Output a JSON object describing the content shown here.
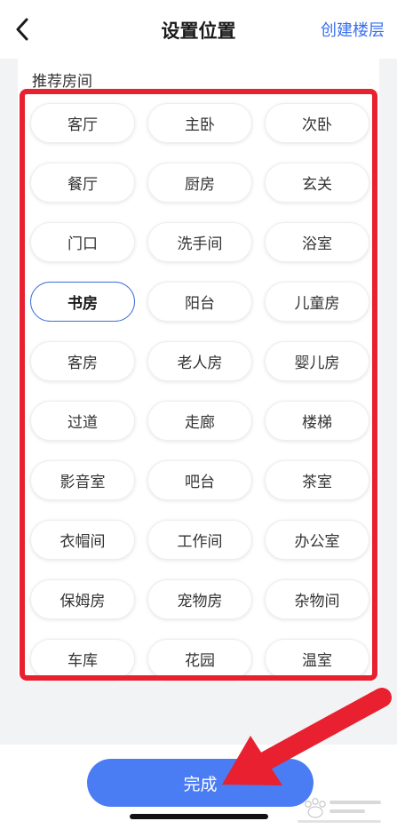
{
  "header": {
    "title": "设置位置",
    "action_label": "创建楼层"
  },
  "section": {
    "label": "推荐房间"
  },
  "rooms": [
    {
      "label": "客厅",
      "selected": false
    },
    {
      "label": "主卧",
      "selected": false
    },
    {
      "label": "次卧",
      "selected": false
    },
    {
      "label": "餐厅",
      "selected": false
    },
    {
      "label": "厨房",
      "selected": false
    },
    {
      "label": "玄关",
      "selected": false
    },
    {
      "label": "门口",
      "selected": false
    },
    {
      "label": "洗手间",
      "selected": false
    },
    {
      "label": "浴室",
      "selected": false
    },
    {
      "label": "书房",
      "selected": true
    },
    {
      "label": "阳台",
      "selected": false
    },
    {
      "label": "儿童房",
      "selected": false
    },
    {
      "label": "客房",
      "selected": false
    },
    {
      "label": "老人房",
      "selected": false
    },
    {
      "label": "婴儿房",
      "selected": false
    },
    {
      "label": "过道",
      "selected": false
    },
    {
      "label": "走廊",
      "selected": false
    },
    {
      "label": "楼梯",
      "selected": false
    },
    {
      "label": "影音室",
      "selected": false
    },
    {
      "label": "吧台",
      "selected": false
    },
    {
      "label": "茶室",
      "selected": false
    },
    {
      "label": "衣帽间",
      "selected": false
    },
    {
      "label": "工作间",
      "selected": false
    },
    {
      "label": "办公室",
      "selected": false
    },
    {
      "label": "保姆房",
      "selected": false
    },
    {
      "label": "宠物房",
      "selected": false
    },
    {
      "label": "杂物间",
      "selected": false
    },
    {
      "label": "车库",
      "selected": false
    },
    {
      "label": "花园",
      "selected": false
    },
    {
      "label": "温室",
      "selected": false
    }
  ],
  "footer": {
    "done_label": "完成"
  },
  "colors": {
    "accent": "#4a7cf3",
    "annotation_red": "#e8202f",
    "selected_border": "#3b6fd8"
  },
  "icons": {
    "back": "back-chevron-icon",
    "annotation": "red-arrow-icon",
    "watermark": "baidu-paw-watermark-icon"
  }
}
